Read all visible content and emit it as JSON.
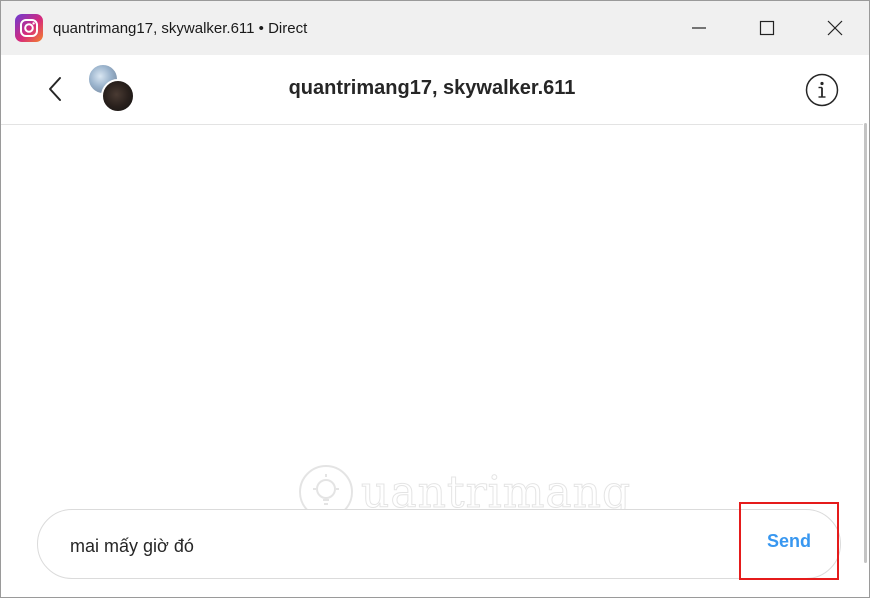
{
  "window": {
    "title": "quantrimang17, skywalker.611 • Direct",
    "app_icon": "instagram-icon"
  },
  "window_controls": {
    "minimize_icon": "minimize-icon",
    "maximize_icon": "maximize-icon",
    "close_icon": "close-icon"
  },
  "header": {
    "back_icon": "chevron-left-icon",
    "title": "quantrimang17, skywalker.611",
    "info_icon": "info-icon"
  },
  "composer": {
    "input_value": "mai mấy giờ đó",
    "send_label": "Send",
    "send_color": "#3897f0",
    "highlight_color": "#e51b1b"
  },
  "watermark": {
    "text": "uantrimang"
  }
}
